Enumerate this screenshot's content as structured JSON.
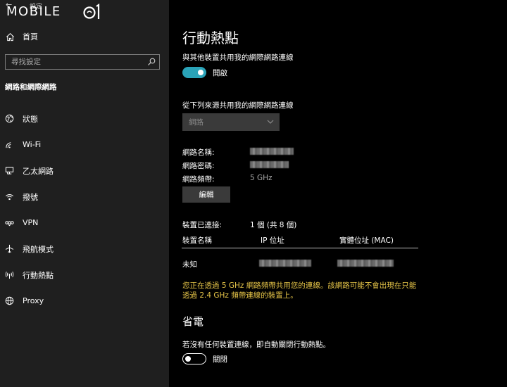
{
  "window": {
    "back": "←",
    "title": "設定"
  },
  "logo": {
    "text": "MOBILE"
  },
  "sidebar": {
    "home_label": "首頁",
    "search_placeholder": "尋找設定",
    "section_title": "網路和網際網路",
    "items": [
      {
        "label": "狀態",
        "icon": "globe-icon"
      },
      {
        "label": "Wi-Fi",
        "icon": "wifi-icon"
      },
      {
        "label": "乙太網路",
        "icon": "ethernet-icon"
      },
      {
        "label": "撥號",
        "icon": "dialup-icon"
      },
      {
        "label": "VPN",
        "icon": "vpn-icon"
      },
      {
        "label": "飛航模式",
        "icon": "airplane-icon"
      },
      {
        "label": "行動熱點",
        "icon": "hotspot-icon"
      },
      {
        "label": "Proxy",
        "icon": "proxy-globe-icon"
      }
    ]
  },
  "main": {
    "title": "行動熱點",
    "share_label": "與其他裝置共用我的網際網路連線",
    "share_toggle": {
      "state": "on",
      "label": "開啟"
    },
    "source_label": "從下列來源共用我的網際網路連線",
    "source_value": "網路",
    "props": [
      {
        "label": "網路名稱:",
        "value": ""
      },
      {
        "label": "網路密碼:",
        "value": ""
      },
      {
        "label": "網路頻帶:",
        "value": "5 GHz"
      }
    ],
    "edit_label": "編輯",
    "connected_label": "裝置已連接:",
    "connected_value": "1 個 (共 8 個)",
    "table": {
      "headers": [
        "裝置名稱",
        "IP 位址",
        "實體位址 (MAC)"
      ],
      "rows": [
        {
          "name": "未知",
          "ip": "",
          "mac": ""
        }
      ]
    },
    "warning": "您正在透過 5 GHz 網路頻帶共用您的連線。該網路可能不會出現在只能透過 2.4 GHz 頻帶連線的裝置上。",
    "power_title": "省電",
    "power_desc": "若沒有任何裝置連線，即自動關閉行動熱點。",
    "power_toggle": {
      "state": "off",
      "label": "關閉"
    }
  },
  "colors": {
    "accent": "#2aa3b8",
    "warning": "#e6c548",
    "sidebar_bg": "#1f1f1f",
    "main_bg": "#000000"
  }
}
